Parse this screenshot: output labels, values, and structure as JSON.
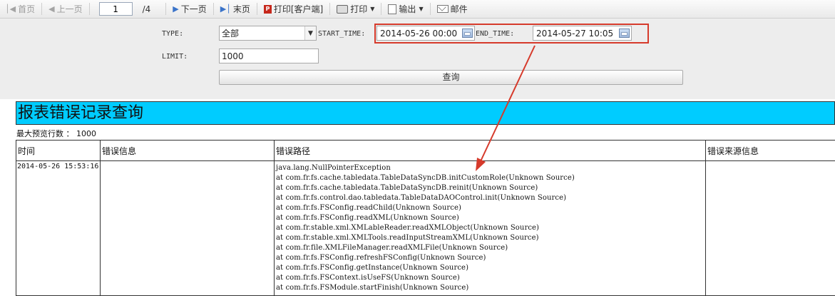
{
  "toolbar": {
    "first": "首页",
    "prev": "上一页",
    "page_value": "1",
    "page_total": "/4",
    "next": "下一页",
    "last": "末页",
    "print_client": "打印[客户端]",
    "print": "打印",
    "export": "输出",
    "mail": "邮件"
  },
  "params": {
    "type_label": "TYPE:",
    "type_value": "全部",
    "start_label": "START_TIME:",
    "start_value": "2014-05-26 00:00",
    "end_label": "END_TIME:",
    "end_value": "2014-05-27 10:05",
    "limit_label": "LIMIT:",
    "limit_value": "1000",
    "query_label": "查询"
  },
  "report": {
    "title": "报表错误记录查询",
    "max_rows": "最大预览行数 ： 1000",
    "headers": [
      "时间",
      "错误信息",
      "错误路径",
      "错误来源信息"
    ],
    "row": {
      "time": "2014-05-26 15:53:16",
      "message": "",
      "source": "",
      "trace": [
        "java.lang.NullPointerException",
        "at com.fr.fs.cache.tabledata.TableDataSyncDB.initCustomRole(Unknown Source)",
        "at com.fr.fs.cache.tabledata.TableDataSyncDB.reinit(Unknown Source)",
        "at com.fr.fs.control.dao.tabledata.TableDataDAOControl.init(Unknown Source)",
        "at com.fr.fs.FSConfig.readChild(Unknown Source)",
        "at com.fr.fs.FSConfig.readXML(Unknown Source)",
        "at com.fr.stable.xml.XMLableReader.readXMLObject(Unknown Source)",
        "at com.fr.stable.xml.XMLTools.readInputStreamXML(Unknown Source)",
        "at com.fr.file.XMLFileManager.readXMLFile(Unknown Source)",
        "at com.fr.fs.FSConfig.refreshFSConfig(Unknown Source)",
        "at com.fr.fs.FSConfig.getInstance(Unknown Source)",
        "at com.fr.fs.FSContext.isUseFS(Unknown Source)",
        "at com.fr.fs.FSModule.startFinish(Unknown Source)"
      ]
    }
  },
  "colors": {
    "title_bg": "#00ccff",
    "annotation_red": "#d63a2b",
    "panel_bg": "#ededed"
  }
}
